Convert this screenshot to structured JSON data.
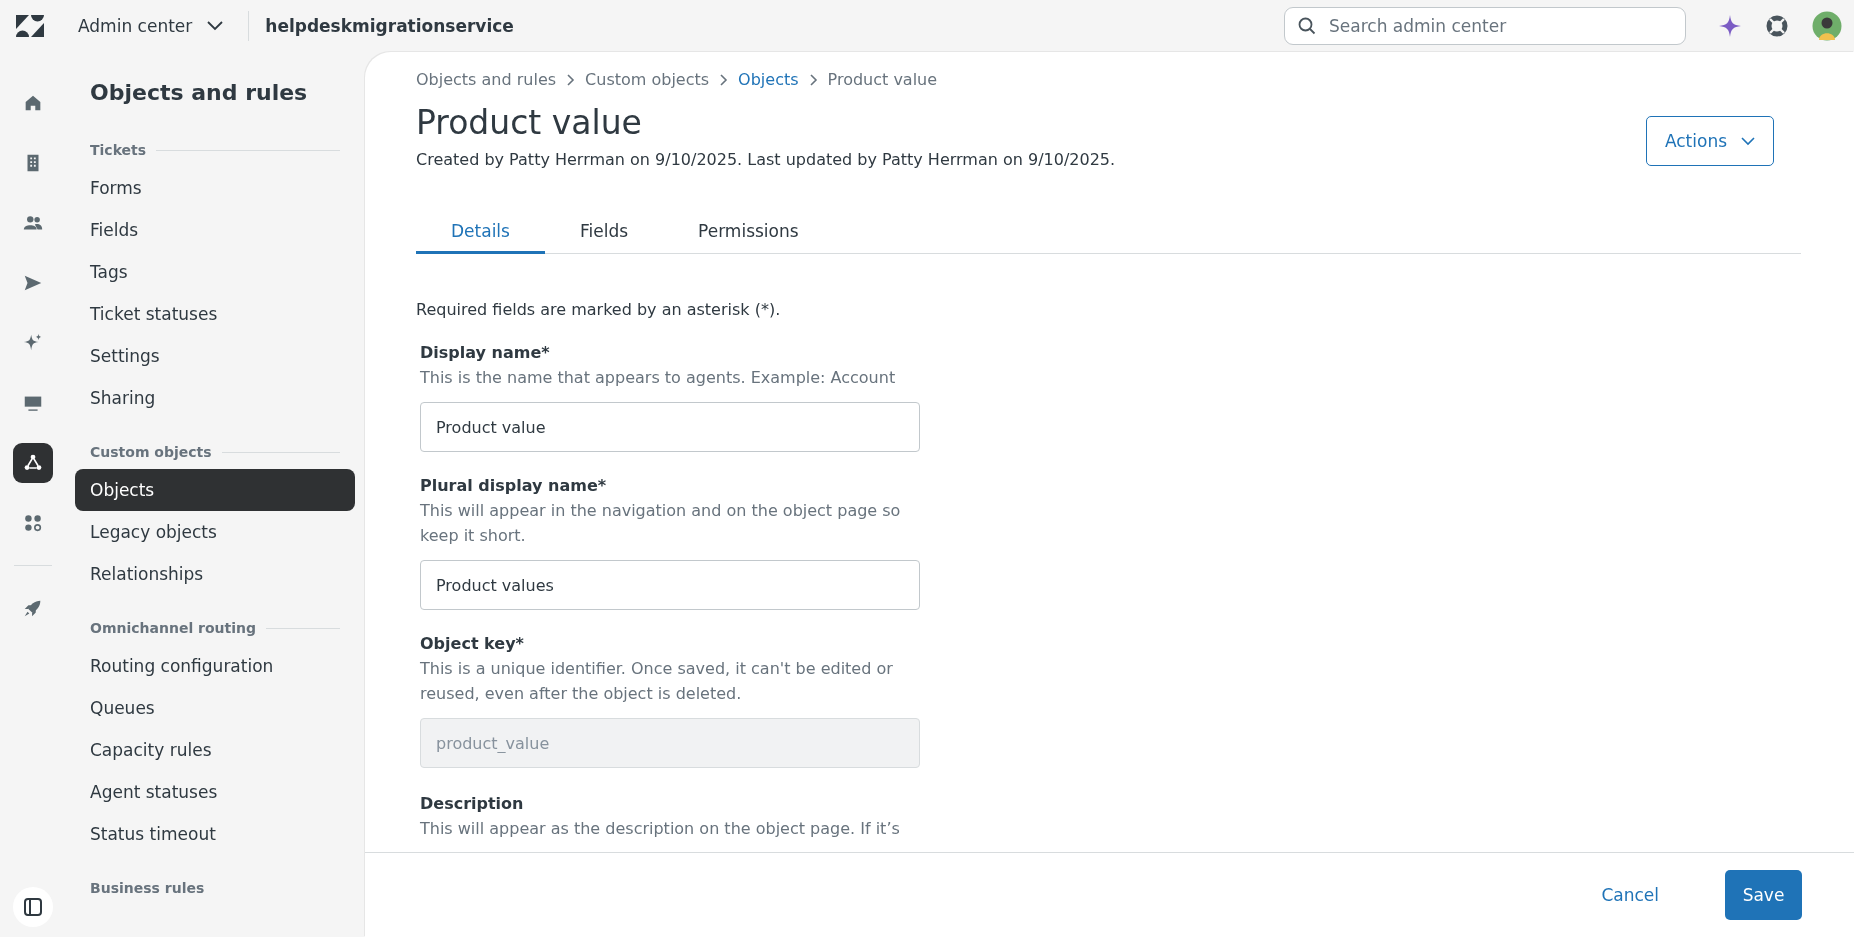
{
  "topbar": {
    "product": "Admin center",
    "account": "helpdeskmigrationservice",
    "search": {
      "placeholder": "Search admin center"
    }
  },
  "rail": {
    "items": [
      {
        "kind": "home",
        "selected": false
      },
      {
        "kind": "building",
        "selected": false
      },
      {
        "kind": "people",
        "selected": false
      },
      {
        "kind": "send",
        "selected": false
      },
      {
        "kind": "sparkle",
        "selected": false
      },
      {
        "kind": "monitor",
        "selected": false
      },
      {
        "kind": "objects",
        "selected": true
      },
      {
        "kind": "apps",
        "selected": false
      }
    ],
    "extra": [
      {
        "kind": "rocket",
        "selected": false
      }
    ]
  },
  "sidebar": {
    "title": "Objects and rules",
    "sections": [
      {
        "heading": "Tickets",
        "items": [
          {
            "label": "Forms",
            "selected": false
          },
          {
            "label": "Fields",
            "selected": false
          },
          {
            "label": "Tags",
            "selected": false
          },
          {
            "label": "Ticket statuses",
            "selected": false
          },
          {
            "label": "Settings",
            "selected": false
          },
          {
            "label": "Sharing",
            "selected": false
          }
        ]
      },
      {
        "heading": "Custom objects",
        "items": [
          {
            "label": "Objects",
            "selected": true
          },
          {
            "label": "Legacy objects",
            "selected": false
          },
          {
            "label": "Relationships",
            "selected": false
          }
        ]
      },
      {
        "heading": "Omnichannel routing",
        "items": [
          {
            "label": "Routing configuration",
            "selected": false
          },
          {
            "label": "Queues",
            "selected": false
          },
          {
            "label": "Capacity rules",
            "selected": false
          },
          {
            "label": "Agent statuses",
            "selected": false
          },
          {
            "label": "Status timeout",
            "selected": false
          }
        ]
      },
      {
        "heading": "Business rules"
      }
    ]
  },
  "page": {
    "breadcrumb": [
      {
        "label": "Objects and rules",
        "link": false
      },
      {
        "label": "Custom objects",
        "link": false
      },
      {
        "label": "Objects",
        "link": true
      },
      {
        "label": "Product value",
        "link": false
      }
    ],
    "title": "Product value",
    "meta": "Created by Patty Herrman on 9/10/2025. Last updated by Patty Herrman on 9/10/2025.",
    "actions": "Actions",
    "tabs": [
      {
        "label": "Details",
        "selected": true
      },
      {
        "label": "Fields",
        "selected": false
      },
      {
        "label": "Permissions",
        "selected": false
      }
    ],
    "required_note": "Required fields are marked by an asterisk (*).",
    "fields": [
      {
        "label": "Display name*",
        "help": "This is the name that appears to agents. Example: Account",
        "value": "Product value",
        "disabled": false
      },
      {
        "label": "Plural display name*",
        "help": "This will appear in the navigation and on the object page so keep it short.",
        "value": "Product values",
        "disabled": false
      },
      {
        "label": "Object key*",
        "help": "This is a unique identifier. Once saved, it can't be edited or reused, even after the object is deleted.",
        "value": "product_value",
        "disabled": true
      }
    ],
    "description": {
      "label": "Description",
      "help": "This will appear as the description on the object page. If it’s"
    },
    "footer": {
      "cancel": "Cancel",
      "save": "Save"
    }
  }
}
